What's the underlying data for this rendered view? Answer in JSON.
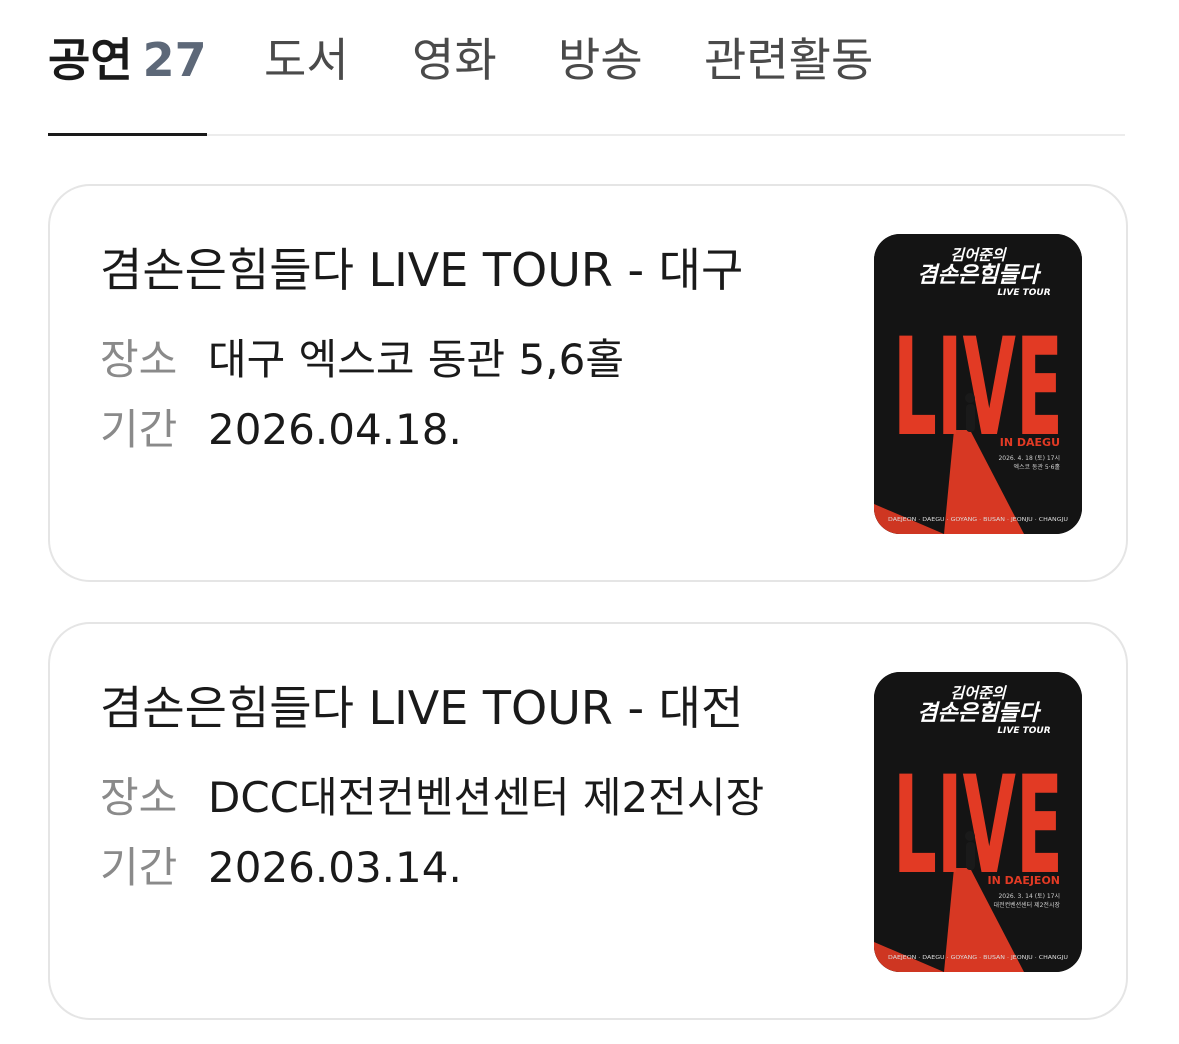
{
  "tabs": [
    {
      "label": "공연",
      "count": "27",
      "active": true
    },
    {
      "label": "도서"
    },
    {
      "label": "영화"
    },
    {
      "label": "방송"
    },
    {
      "label": "관련활동"
    }
  ],
  "labels": {
    "venue": "장소",
    "period": "기간"
  },
  "performances": [
    {
      "title": "겸손은힘들다 LIVE TOUR - 대구",
      "venue": "대구 엑스코 동관 5,6홀",
      "period": "2026.04.18.",
      "poster": {
        "top_line": "김어준의",
        "title_line": "겸손은힘들다",
        "subtitle": "LIVE TOUR",
        "big": "LIVE",
        "city": "IN DAEGU",
        "date_line": "2026. 4. 18 (토) 17시",
        "venue_line": "엑스코 동관 5·6홀",
        "route": "DAEJEON · DAEGU · GOYANG · BUSAN · JEONJU · CHANGJU"
      }
    },
    {
      "title": "겸손은힘들다 LIVE TOUR - 대전",
      "venue": "DCC대전컨벤션센터 제2전시장",
      "period": "2026.03.14.",
      "poster": {
        "top_line": "김어준의",
        "title_line": "겸손은힘들다",
        "subtitle": "LIVE TOUR",
        "big": "LIVE",
        "city": "IN DAEJEON",
        "date_line": "2026. 3. 14 (토) 17시",
        "venue_line": "대전컨벤션센터 제2전시장",
        "route": "DAEJEON · DAEGU · GOYANG · BUSAN · JEONJU · CHANGJU"
      }
    }
  ],
  "colors": {
    "poster_red": "#e23a24",
    "poster_bg": "#141414",
    "tab_count": "#5d6878"
  }
}
